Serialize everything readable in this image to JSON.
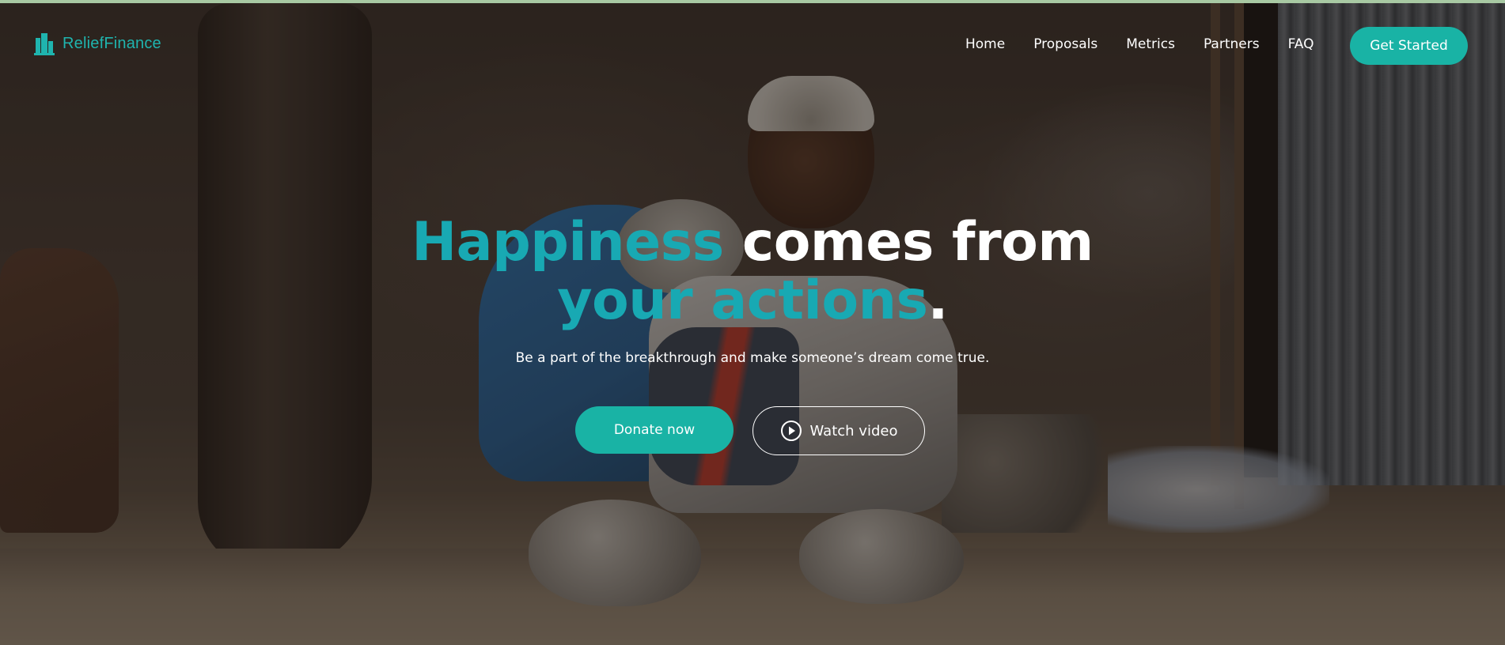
{
  "brand": {
    "name": "ReliefFinance",
    "logo_icon": "building-icon",
    "color": "#1fb4ae"
  },
  "nav": {
    "items": [
      {
        "label": "Home"
      },
      {
        "label": "Proposals"
      },
      {
        "label": "Metrics"
      },
      {
        "label": "Partners"
      },
      {
        "label": "FAQ"
      }
    ],
    "cta_label": "Get Started"
  },
  "hero": {
    "title_part1": "Happiness",
    "title_part2": "comes from",
    "title_part3": "your actions",
    "title_part4": ".",
    "subtitle": "Be a part of the breakthrough and make someone’s dream come true.",
    "donate_label": "Donate now",
    "video_label": "Watch video",
    "video_icon": "play-circle-icon"
  },
  "colors": {
    "accent": "#19b3a5",
    "title_accent": "#18a9b3",
    "text": "#ffffff"
  }
}
